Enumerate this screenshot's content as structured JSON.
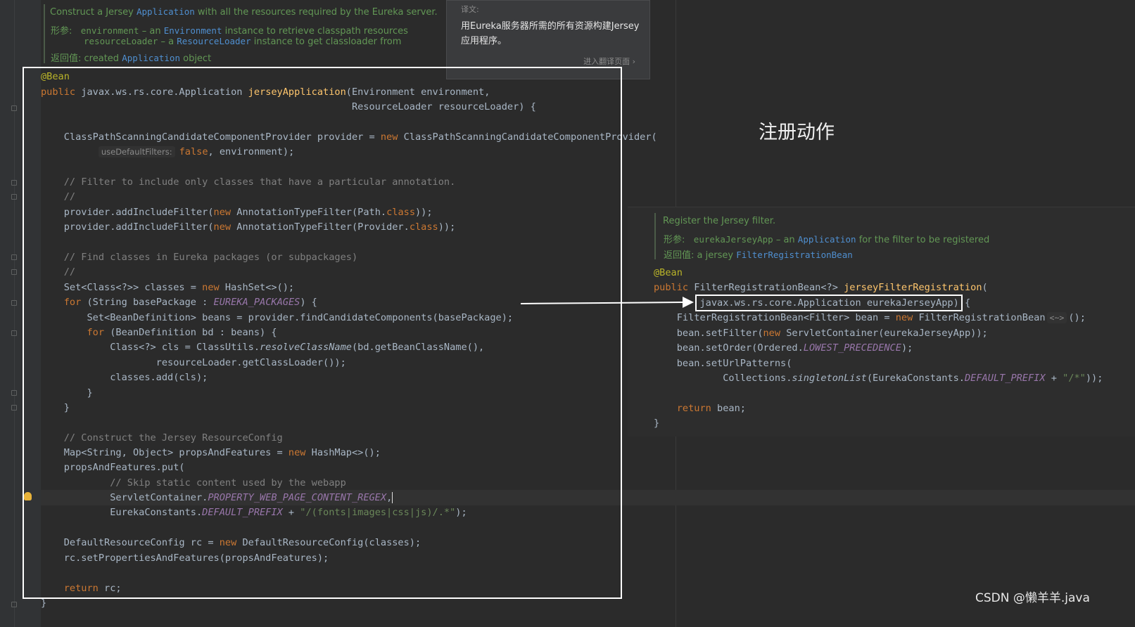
{
  "left_doc": {
    "summary_pre": "Construct a Jersey ",
    "summary_link": "Application",
    "summary_post": " with all the resources required by the Eureka server.",
    "params_label": "形参:",
    "param1_name": "environment",
    "param1_mid": " – an ",
    "param1_type": "Environment",
    "param1_post": " instance to retrieve classpath resources",
    "param2_name": "resourceLoader",
    "param2_mid": " – a ",
    "param2_type": "ResourceLoader",
    "param2_post": " instance to get classloader from",
    "returns_label": "返回值:",
    "returns_pre": " created ",
    "returns_link": "Application",
    "returns_post": " object"
  },
  "translation_popup": {
    "label": "译文:",
    "text": "用Eureka服务器所需的所有资源构建Jersey应用程序。",
    "link": "进入翻译页面 ›"
  },
  "big_title": "注册动作",
  "left_code": {
    "l01": "@Bean",
    "l02_a": "public javax.ws.rs.core.Application ",
    "l02_fn": "jerseyApplication",
    "l02_b": "(Environment environment,",
    "l03": "                                                      ResourceLoader resourceLoader) {",
    "l05_a": "    ClassPathScanningCandidateComponentProvider provider = ",
    "l05_kw": "new",
    "l05_b": " ClassPathScanningCandidateComponentProvider(",
    "l06_hint": "useDefaultFilters:",
    "l06_kw": "false",
    "l06_b": ", environment);",
    "l08": "    // Filter to include only classes that have a particular annotation.",
    "l09": "    //",
    "l10_a": "    provider.addIncludeFilter(",
    "l10_kw": "new",
    "l10_b": " AnnotationTypeFilter(Path.",
    "l10_kw2": "class",
    "l10_c": "));",
    "l11_a": "    provider.addIncludeFilter(",
    "l11_kw": "new",
    "l11_b": " AnnotationTypeFilter(Provider.",
    "l11_kw2": "class",
    "l11_c": "));",
    "l13": "    // Find classes in Eureka packages (or subpackages)",
    "l14": "    //",
    "l15_a": "    Set<Class<?>> classes = ",
    "l15_kw": "new",
    "l15_b": " HashSet<>();",
    "l16_kw": "    for",
    "l16_a": " (String basePackage : ",
    "l16_cn": "EUREKA_PACKAGES",
    "l16_b": ") {",
    "l17": "        Set<BeanDefinition> beans = provider.findCandidateComponents(basePackage);",
    "l18_kw": "        for",
    "l18_a": " (BeanDefinition bd : beans) {",
    "l19_a": "            Class<?> cls = ClassUtils.",
    "l19_it": "resolveClassName",
    "l19_b": "(bd.getBeanClassName(),",
    "l20": "                    resourceLoader.getClassLoader());",
    "l21": "            classes.add(cls);",
    "l22": "        }",
    "l23": "    }",
    "l25": "    // Construct the Jersey ResourceConfig",
    "l26_a": "    Map<String, Object> propsAndFeatures = ",
    "l26_kw": "new",
    "l26_b": " HashMap<>();",
    "l27": "    propsAndFeatures.put(",
    "l28": "            // Skip static content used by the webapp",
    "l29_a": "            ServletContainer.",
    "l29_cn": "PROPERTY_WEB_PAGE_CONTENT_REGEX",
    "l29_b": ",",
    "l30_a": "            EurekaConstants.",
    "l30_cn": "DEFAULT_PREFIX",
    "l30_b": " + ",
    "l30_st": "\"/(fonts|images|css|js)/.*\"",
    "l30_c": ");",
    "l32_a": "    DefaultResourceConfig rc = ",
    "l32_kw": "new",
    "l32_b": " DefaultResourceConfig(classes);",
    "l33": "    rc.setPropertiesAndFeatures(propsAndFeatures);",
    "l35_kw": "    return",
    "l35_a": " rc;",
    "l36": "}"
  },
  "right_doc": {
    "summary": "Register the Jersey filter.",
    "params_label": "形参:",
    "param_name": "eurekaJerseyApp",
    "param_mid": " – an ",
    "param_type": "Application",
    "param_post": " for the filter to be registered",
    "returns_label": "返回值:",
    "returns_pre": " a jersey ",
    "returns_link": "FilterRegistrationBean"
  },
  "right_code": {
    "r01": "@Bean",
    "r02_kw": "public",
    "r02_a": " FilterRegistrationBean<?> ",
    "r02_fn": "jerseyFilterRegistration",
    "r02_b": "(",
    "r03": "        javax.ws.rs.core.Application eurekaJerseyApp) {",
    "r04_a": "    FilterRegistrationBean<Filter> bean = ",
    "r04_kw": "new",
    "r04_b": " FilterRegistrationBean",
    "r04_hint": "<~>",
    "r04_c": "();",
    "r05_a": "    bean.setFilter(",
    "r05_kw": "new",
    "r05_b": " ServletContainer(eurekaJerseyApp));",
    "r06_a": "    bean.setOrder(Ordered.",
    "r06_cn": "LOWEST_PRECEDENCE",
    "r06_b": ");",
    "r07": "    bean.setUrlPatterns(",
    "r08_a": "            Collections.",
    "r08_it": "singletonList",
    "r08_b": "(EurekaConstants.",
    "r08_cn": "DEFAULT_PREFIX",
    "r08_c": " + ",
    "r08_st": "\"/*\"",
    "r08_d": "));",
    "r10_kw": "    return",
    "r10_a": " bean;",
    "r11": "}"
  },
  "watermark": "CSDN @懒羊羊.java"
}
